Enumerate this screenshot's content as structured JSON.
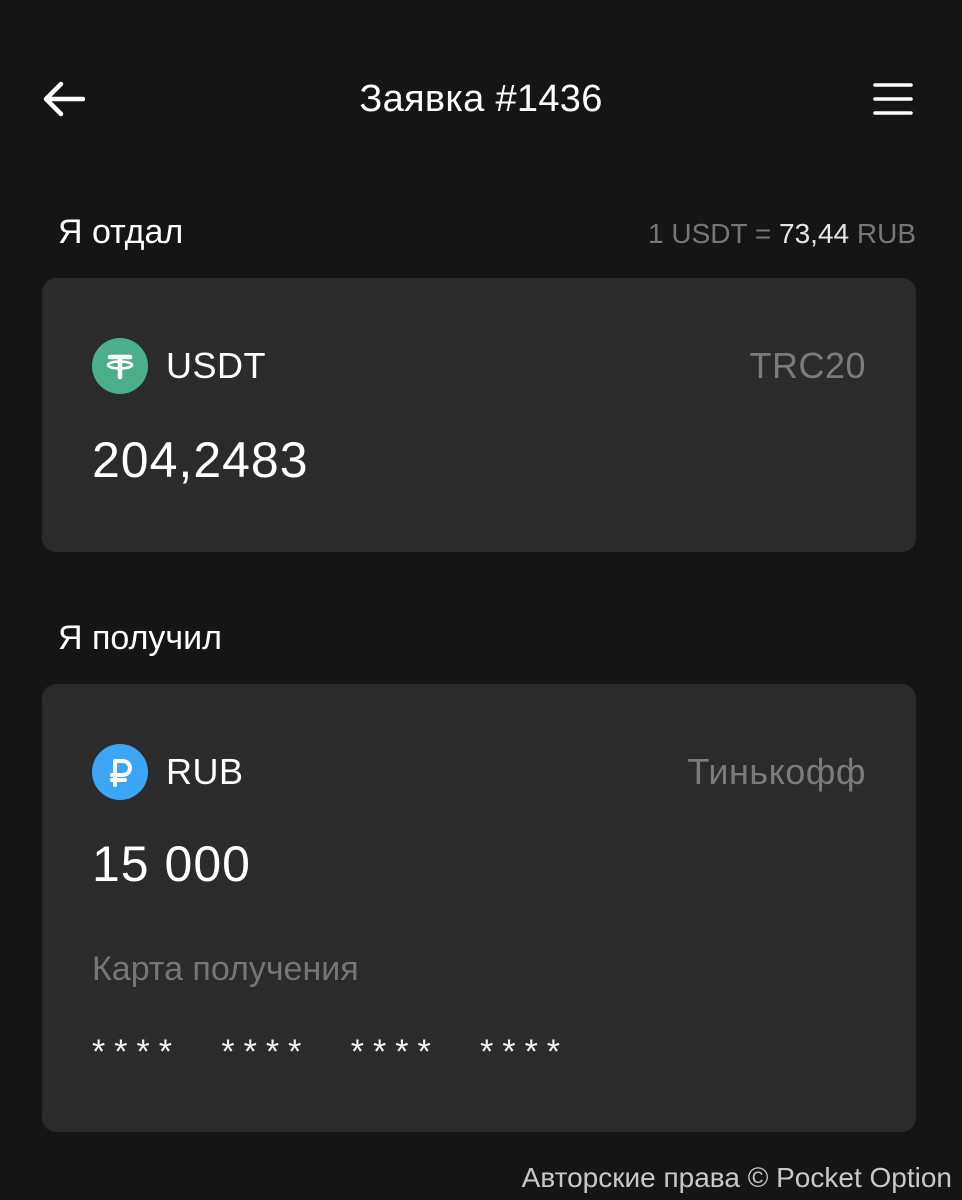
{
  "header": {
    "title": "Заявка #1436",
    "back_icon": "arrow-left-icon",
    "menu_icon": "hamburger-menu-icon"
  },
  "gave": {
    "label": "Я отдал",
    "rate": {
      "left": "1 USDT",
      "eq": "=",
      "value": "73,44",
      "currency": "RUB"
    },
    "currency": "USDT",
    "currency_icon": "tether-icon",
    "network": "TRC20",
    "amount": "204,2483"
  },
  "received": {
    "label": "Я получил",
    "currency": "RUB",
    "currency_icon": "ruble-icon",
    "bank": "Тинькофф",
    "amount": "15 000",
    "card_label": "Карта получения",
    "card_number": "**** **** **** ****"
  },
  "watermark": "Авторские права © Pocket Option",
  "colors": {
    "background": "#151515",
    "card": "#2b2b2b",
    "tether": "#4caf8b",
    "ruble": "#3aa6f5",
    "muted": "#777777"
  }
}
